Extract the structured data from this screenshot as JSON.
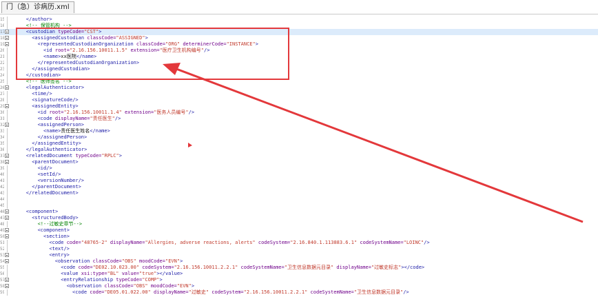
{
  "tab": {
    "label": "门（急）诊病历.xml"
  },
  "colors": {
    "tag": "#1a1aa6",
    "attr": "#6f008a",
    "value": "#c0392b",
    "comment": "#008000",
    "highlight": "#dcebfb",
    "annotation": "#e3383b"
  },
  "icons": {
    "fold": "collapse-box-icon"
  },
  "lines": [
    {
      "n": "15",
      "fold": false,
      "hl": false,
      "indent": 4,
      "parts": [
        [
          "t",
          "</author>"
        ]
      ]
    },
    {
      "n": "16",
      "fold": false,
      "hl": false,
      "indent": 4,
      "parts": [
        [
          "c",
          "<!-- 保管机构 -->"
        ]
      ]
    },
    {
      "n": "17",
      "fold": true,
      "hl": true,
      "indent": 4,
      "parts": [
        [
          "t",
          "<custodian "
        ],
        [
          "a",
          "typeCode="
        ],
        [
          "v",
          "\"CST\""
        ],
        [
          "t",
          ">"
        ]
      ]
    },
    {
      "n": "18",
      "fold": true,
      "hl": false,
      "indent": 6,
      "parts": [
        [
          "t",
          "<assignedCustodian "
        ],
        [
          "a",
          "classCode="
        ],
        [
          "v",
          "\"ASSIGNED\""
        ],
        [
          "t",
          ">"
        ]
      ]
    },
    {
      "n": "19",
      "fold": true,
      "hl": false,
      "indent": 8,
      "parts": [
        [
          "t",
          "<representedCustodianOrganization "
        ],
        [
          "a",
          "classCode="
        ],
        [
          "v",
          "\"ORG\""
        ],
        [
          "a",
          " determinerCode="
        ],
        [
          "v",
          "\"INSTANCE\""
        ],
        [
          "t",
          ">"
        ]
      ]
    },
    {
      "n": "20",
      "fold": false,
      "hl": false,
      "indent": 10,
      "parts": [
        [
          "t",
          "<id "
        ],
        [
          "a",
          "root="
        ],
        [
          "v",
          "\"2.16.156.10011.1.5\""
        ],
        [
          "a",
          " extension="
        ],
        [
          "v",
          "\"医疗卫生机构编号\""
        ],
        [
          "t",
          "/>"
        ]
      ]
    },
    {
      "n": "21",
      "fold": false,
      "hl": false,
      "indent": 10,
      "parts": [
        [
          "t",
          "<name>"
        ],
        [
          "x",
          "xx医院"
        ],
        [
          "t",
          "</name>"
        ]
      ]
    },
    {
      "n": "22",
      "fold": false,
      "hl": false,
      "indent": 8,
      "parts": [
        [
          "t",
          "</representedCustodianOrganization>"
        ]
      ]
    },
    {
      "n": "23",
      "fold": false,
      "hl": false,
      "indent": 6,
      "parts": [
        [
          "t",
          "</assignedCustodian>"
        ]
      ]
    },
    {
      "n": "24",
      "fold": false,
      "hl": false,
      "indent": 4,
      "parts": [
        [
          "t",
          "</custodian>"
        ]
      ]
    },
    {
      "n": "25",
      "fold": false,
      "hl": false,
      "indent": 4,
      "parts": [
        [
          "c",
          "<!-- 医师签名 -->"
        ]
      ]
    },
    {
      "n": "26",
      "fold": true,
      "hl": false,
      "indent": 4,
      "parts": [
        [
          "t",
          "<legalAuthenticator>"
        ]
      ]
    },
    {
      "n": "27",
      "fold": false,
      "hl": false,
      "indent": 6,
      "parts": [
        [
          "t",
          "<time/>"
        ]
      ]
    },
    {
      "n": "28",
      "fold": false,
      "hl": false,
      "indent": 6,
      "parts": [
        [
          "t",
          "<signatureCode/>"
        ]
      ]
    },
    {
      "n": "29",
      "fold": true,
      "hl": false,
      "indent": 6,
      "parts": [
        [
          "t",
          "<assignedEntity>"
        ]
      ]
    },
    {
      "n": "30",
      "fold": false,
      "hl": false,
      "indent": 8,
      "parts": [
        [
          "t",
          "<id "
        ],
        [
          "a",
          "root="
        ],
        [
          "v",
          "\"2.16.156.10011.1.4\""
        ],
        [
          "a",
          " extension="
        ],
        [
          "v",
          "\"医务人员编号\""
        ],
        [
          "t",
          "/>"
        ]
      ]
    },
    {
      "n": "31",
      "fold": false,
      "hl": false,
      "indent": 8,
      "parts": [
        [
          "t",
          "<code "
        ],
        [
          "a",
          "displayName="
        ],
        [
          "v",
          "\"责任医生\""
        ],
        [
          "t",
          "/>"
        ]
      ]
    },
    {
      "n": "32",
      "fold": true,
      "hl": false,
      "indent": 8,
      "parts": [
        [
          "t",
          "<assignedPerson>"
        ]
      ]
    },
    {
      "n": "33",
      "fold": false,
      "hl": false,
      "indent": 10,
      "parts": [
        [
          "t",
          "<name>"
        ],
        [
          "x",
          "责任医生姓名"
        ],
        [
          "t",
          "</name>"
        ]
      ]
    },
    {
      "n": "34",
      "fold": false,
      "hl": false,
      "indent": 8,
      "parts": [
        [
          "t",
          "</assignedPerson>"
        ]
      ]
    },
    {
      "n": "35",
      "fold": false,
      "hl": false,
      "indent": 6,
      "parts": [
        [
          "t",
          "</assignedEntity>"
        ]
      ]
    },
    {
      "n": "36",
      "fold": false,
      "hl": false,
      "indent": 4,
      "parts": [
        [
          "t",
          "</legalAuthenticator>"
        ]
      ]
    },
    {
      "n": "37",
      "fold": true,
      "hl": false,
      "indent": 4,
      "parts": [
        [
          "t",
          "<relatedDocument "
        ],
        [
          "a",
          "typeCode="
        ],
        [
          "v",
          "\"RPLC\""
        ],
        [
          "t",
          ">"
        ]
      ]
    },
    {
      "n": "38",
      "fold": true,
      "hl": false,
      "indent": 6,
      "parts": [
        [
          "t",
          "<parentDocument>"
        ]
      ]
    },
    {
      "n": "39",
      "fold": false,
      "hl": false,
      "indent": 8,
      "parts": [
        [
          "t",
          "<id/>"
        ]
      ]
    },
    {
      "n": "40",
      "fold": false,
      "hl": false,
      "indent": 8,
      "parts": [
        [
          "t",
          "<setId/>"
        ]
      ]
    },
    {
      "n": "41",
      "fold": false,
      "hl": false,
      "indent": 8,
      "parts": [
        [
          "t",
          "<versionNumber/>"
        ]
      ]
    },
    {
      "n": "42",
      "fold": false,
      "hl": false,
      "indent": 6,
      "parts": [
        [
          "t",
          "</parentDocument>"
        ]
      ]
    },
    {
      "n": "43",
      "fold": false,
      "hl": false,
      "indent": 4,
      "parts": [
        [
          "t",
          "</relatedDocument>"
        ]
      ]
    },
    {
      "n": "44",
      "fold": false,
      "hl": false,
      "indent": 0,
      "parts": []
    },
    {
      "n": "45",
      "fold": false,
      "hl": false,
      "indent": 0,
      "parts": []
    },
    {
      "n": "46",
      "fold": true,
      "hl": false,
      "indent": 4,
      "parts": [
        [
          "t",
          "<component>"
        ]
      ]
    },
    {
      "n": "47",
      "fold": true,
      "hl": false,
      "indent": 6,
      "parts": [
        [
          "t",
          "<structuredBody>"
        ]
      ]
    },
    {
      "n": "48",
      "fold": false,
      "hl": false,
      "indent": 8,
      "parts": [
        [
          "c",
          "<!--过敏史章节-->"
        ]
      ]
    },
    {
      "n": "49",
      "fold": true,
      "hl": false,
      "indent": 8,
      "parts": [
        [
          "t",
          "<component>"
        ]
      ]
    },
    {
      "n": "50",
      "fold": true,
      "hl": false,
      "indent": 10,
      "parts": [
        [
          "t",
          "<section>"
        ]
      ]
    },
    {
      "n": "51",
      "fold": false,
      "hl": false,
      "indent": 12,
      "parts": [
        [
          "t",
          "<code "
        ],
        [
          "a",
          "code="
        ],
        [
          "v",
          "\"48765-2\""
        ],
        [
          "a",
          " displayName="
        ],
        [
          "v",
          "\"Allergies, adverse reactions, alerts\""
        ],
        [
          "a",
          " codeSystem="
        ],
        [
          "v",
          "\"2.16.840.1.113883.6.1\""
        ],
        [
          "a",
          " codeSystemName="
        ],
        [
          "v",
          "\"LOINC\""
        ],
        [
          "t",
          "/>"
        ]
      ]
    },
    {
      "n": "52",
      "fold": false,
      "hl": false,
      "indent": 12,
      "parts": [
        [
          "t",
          "<text/>"
        ]
      ]
    },
    {
      "n": "53",
      "fold": true,
      "hl": false,
      "indent": 12,
      "parts": [
        [
          "t",
          "<entry>"
        ]
      ]
    },
    {
      "n": "54",
      "fold": true,
      "hl": false,
      "indent": 14,
      "parts": [
        [
          "t",
          "<observation "
        ],
        [
          "a",
          "classCode="
        ],
        [
          "v",
          "\"OBS\""
        ],
        [
          "a",
          " moodCode="
        ],
        [
          "v",
          "\"EVN\""
        ],
        [
          "t",
          ">"
        ]
      ]
    },
    {
      "n": "55",
      "fold": false,
      "hl": false,
      "indent": 16,
      "parts": [
        [
          "t",
          "<code "
        ],
        [
          "a",
          "code="
        ],
        [
          "v",
          "\"DE02.10.023.00\""
        ],
        [
          "a",
          " codeSystem="
        ],
        [
          "v",
          "\"2.16.156.10011.2.2.1\""
        ],
        [
          "a",
          " codeSystemName="
        ],
        [
          "v",
          "\"卫生信息数据元目录\""
        ],
        [
          "a",
          " displayName="
        ],
        [
          "v",
          "\"过敏史标志\""
        ],
        [
          "t",
          "></code>"
        ]
      ]
    },
    {
      "n": "56",
      "fold": false,
      "hl": false,
      "indent": 16,
      "parts": [
        [
          "t",
          "<value "
        ],
        [
          "a",
          "xsi:type="
        ],
        [
          "v",
          "\"BL\""
        ],
        [
          "a",
          " value="
        ],
        [
          "v",
          "\"true\""
        ],
        [
          "t",
          "></value>"
        ]
      ]
    },
    {
      "n": "57",
      "fold": true,
      "hl": false,
      "indent": 16,
      "parts": [
        [
          "t",
          "<entryRelationship "
        ],
        [
          "a",
          "typeCode="
        ],
        [
          "v",
          "\"COMP\""
        ],
        [
          "t",
          ">"
        ]
      ]
    },
    {
      "n": "58",
      "fold": true,
      "hl": false,
      "indent": 18,
      "parts": [
        [
          "t",
          "<observation "
        ],
        [
          "a",
          "classCode="
        ],
        [
          "v",
          "\"OBS\""
        ],
        [
          "a",
          " moodCode="
        ],
        [
          "v",
          "\"EVN\""
        ],
        [
          "t",
          ">"
        ]
      ]
    },
    {
      "n": "59",
      "fold": false,
      "hl": false,
      "indent": 20,
      "parts": [
        [
          "t",
          "<code "
        ],
        [
          "a",
          "code="
        ],
        [
          "v",
          "\"DE05.01.022.00\""
        ],
        [
          "a",
          " displayName="
        ],
        [
          "v",
          "\"过敏史\""
        ],
        [
          "a",
          " codeSystem="
        ],
        [
          "v",
          "\"2.16.156.10011.2.2.1\""
        ],
        [
          "a",
          " codeSystemName="
        ],
        [
          "v",
          "\"卫生信息数据元目录\""
        ],
        [
          "t",
          "/>"
        ]
      ]
    }
  ]
}
